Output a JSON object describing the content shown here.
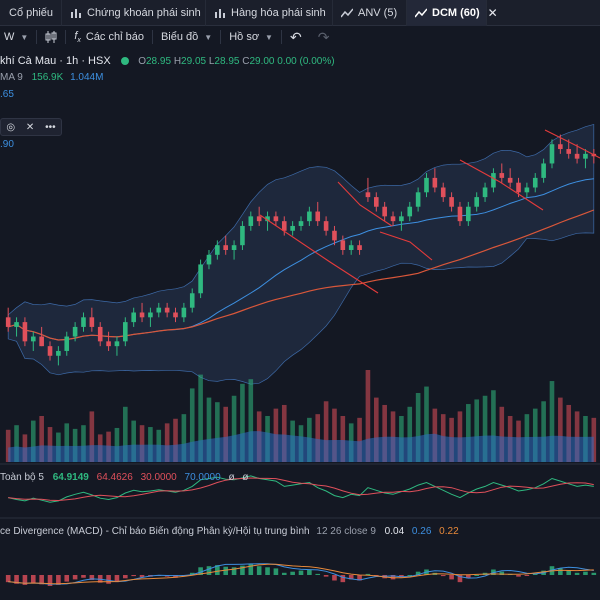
{
  "tabs": [
    {
      "label": "Cổ phiếu",
      "icon": "stock-icon",
      "active": false
    },
    {
      "label": "Chứng khoán phái sinh",
      "icon": "chart-bars-icon",
      "active": false
    },
    {
      "label": "Hàng hóa phái sinh",
      "icon": "chart-bars-icon",
      "active": false
    },
    {
      "label": "ANV (5)",
      "icon": "chart-line-icon",
      "active": false
    },
    {
      "label": "DCM (60)",
      "icon": "chart-line-icon",
      "active": true
    }
  ],
  "toolbar": {
    "interval_label": "W",
    "indicators_label": "Các chỉ báo",
    "chart_type_label": "Biểu đồ",
    "profile_label": "Hồ sơ"
  },
  "legend": {
    "symbol": "khí Cà Mau · 1h · HSX",
    "open_key": "O",
    "open": "28.95",
    "high_key": "H",
    "high": "29.05",
    "low_key": "L",
    "low": "28.95",
    "close_key": "C",
    "close": "29.00",
    "change": "0.00 (0.00%)"
  },
  "ma_row": {
    "label": "MA 9",
    "v1": "156.9K",
    "v2": "1.044M"
  },
  "price_labels": {
    "a": ".65",
    "b": ".90"
  },
  "rsi": {
    "name": "Toàn bộ 5",
    "v1": "64.9149",
    "v2": "64.4626",
    "v3": "30.0000",
    "v4": "70.0000",
    "v5": "ø",
    "v6": "ø"
  },
  "macd": {
    "name": "ce Divergence (MACD) - Chỉ báo Biến động Phân kỳ/Hội tụ trung bình",
    "params": "12 26 close 9",
    "v1": "0.04",
    "v2": "0.26",
    "v3": "0.22"
  },
  "colors": {
    "up": "#2fb980",
    "down": "#e0505b",
    "ma_fast": "#3d8fe0",
    "ma_slow": "#d9573a",
    "band_fill": "#2a3c5c",
    "annotation": "#e43b3b"
  },
  "chart_data": {
    "type": "candlestick",
    "price_ohlc": [
      [
        25.6,
        25.8,
        25.3,
        25.4
      ],
      [
        25.4,
        25.6,
        25.2,
        25.5
      ],
      [
        25.5,
        25.6,
        25.0,
        25.1
      ],
      [
        25.1,
        25.3,
        24.9,
        25.2
      ],
      [
        25.2,
        25.4,
        25.0,
        25.0
      ],
      [
        25.0,
        25.1,
        24.7,
        24.8
      ],
      [
        24.8,
        25.0,
        24.6,
        24.9
      ],
      [
        24.9,
        25.3,
        24.8,
        25.2
      ],
      [
        25.2,
        25.5,
        25.1,
        25.4
      ],
      [
        25.4,
        25.7,
        25.3,
        25.6
      ],
      [
        25.6,
        25.8,
        25.3,
        25.4
      ],
      [
        25.4,
        25.5,
        25.0,
        25.1
      ],
      [
        25.1,
        25.3,
        24.9,
        25.0
      ],
      [
        25.0,
        25.2,
        24.8,
        25.1
      ],
      [
        25.1,
        25.6,
        25.0,
        25.5
      ],
      [
        25.5,
        25.8,
        25.4,
        25.7
      ],
      [
        25.7,
        25.9,
        25.5,
        25.6
      ],
      [
        25.6,
        25.8,
        25.4,
        25.7
      ],
      [
        25.7,
        25.9,
        25.6,
        25.8
      ],
      [
        25.8,
        25.9,
        25.6,
        25.7
      ],
      [
        25.7,
        25.8,
        25.5,
        25.6
      ],
      [
        25.6,
        25.9,
        25.5,
        25.8
      ],
      [
        25.8,
        26.2,
        25.7,
        26.1
      ],
      [
        26.1,
        26.8,
        26.0,
        26.7
      ],
      [
        26.7,
        27.0,
        26.6,
        26.9
      ],
      [
        26.9,
        27.2,
        26.8,
        27.1
      ],
      [
        27.1,
        27.3,
        26.9,
        27.0
      ],
      [
        27.0,
        27.2,
        26.8,
        27.1
      ],
      [
        27.1,
        27.6,
        27.0,
        27.5
      ],
      [
        27.5,
        27.8,
        27.4,
        27.7
      ],
      [
        27.7,
        27.9,
        27.5,
        27.6
      ],
      [
        27.6,
        27.8,
        27.4,
        27.7
      ],
      [
        27.7,
        27.8,
        27.5,
        27.6
      ],
      [
        27.6,
        27.7,
        27.3,
        27.4
      ],
      [
        27.4,
        27.6,
        27.3,
        27.5
      ],
      [
        27.5,
        27.7,
        27.4,
        27.6
      ],
      [
        27.6,
        27.9,
        27.5,
        27.8
      ],
      [
        27.8,
        28.0,
        27.5,
        27.6
      ],
      [
        27.6,
        27.7,
        27.3,
        27.4
      ],
      [
        27.4,
        27.5,
        27.1,
        27.2
      ],
      [
        27.2,
        27.3,
        26.9,
        27.0
      ],
      [
        27.0,
        27.2,
        26.9,
        27.1
      ],
      [
        27.1,
        27.2,
        26.9,
        27.0
      ],
      [
        28.2,
        28.5,
        28.0,
        28.1
      ],
      [
        28.1,
        28.2,
        27.8,
        27.9
      ],
      [
        27.9,
        28.0,
        27.6,
        27.7
      ],
      [
        27.7,
        27.8,
        27.5,
        27.6
      ],
      [
        27.6,
        27.8,
        27.4,
        27.7
      ],
      [
        27.7,
        28.0,
        27.6,
        27.9
      ],
      [
        27.9,
        28.3,
        27.8,
        28.2
      ],
      [
        28.2,
        28.6,
        28.1,
        28.5
      ],
      [
        28.5,
        28.7,
        28.2,
        28.3
      ],
      [
        28.3,
        28.4,
        28.0,
        28.1
      ],
      [
        28.1,
        28.2,
        27.8,
        27.9
      ],
      [
        27.9,
        28.0,
        27.5,
        27.6
      ],
      [
        27.6,
        28.0,
        27.5,
        27.9
      ],
      [
        27.9,
        28.2,
        27.8,
        28.1
      ],
      [
        28.1,
        28.4,
        28.0,
        28.3
      ],
      [
        28.3,
        28.7,
        28.2,
        28.6
      ],
      [
        28.6,
        28.8,
        28.4,
        28.5
      ],
      [
        28.5,
        28.7,
        28.3,
        28.4
      ],
      [
        28.4,
        28.5,
        28.1,
        28.2
      ],
      [
        28.2,
        28.4,
        28.1,
        28.3
      ],
      [
        28.3,
        28.6,
        28.2,
        28.5
      ],
      [
        28.5,
        28.9,
        28.4,
        28.8
      ],
      [
        28.8,
        29.3,
        28.7,
        29.2
      ],
      [
        29.2,
        29.4,
        29.0,
        29.1
      ],
      [
        29.1,
        29.3,
        28.9,
        29.0
      ],
      [
        29.0,
        29.2,
        28.8,
        28.9
      ],
      [
        28.9,
        29.1,
        28.7,
        29.0
      ],
      [
        29.0,
        29.1,
        28.8,
        28.95
      ]
    ],
    "volume": [
      0.35,
      0.4,
      0.3,
      0.45,
      0.5,
      0.38,
      0.32,
      0.42,
      0.36,
      0.4,
      0.55,
      0.3,
      0.33,
      0.37,
      0.6,
      0.45,
      0.4,
      0.38,
      0.35,
      0.42,
      0.47,
      0.52,
      0.8,
      0.95,
      0.7,
      0.65,
      0.6,
      0.72,
      0.85,
      0.9,
      0.55,
      0.5,
      0.58,
      0.62,
      0.45,
      0.4,
      0.48,
      0.52,
      0.66,
      0.58,
      0.5,
      0.42,
      0.48,
      1.0,
      0.7,
      0.62,
      0.55,
      0.5,
      0.6,
      0.75,
      0.82,
      0.58,
      0.52,
      0.48,
      0.55,
      0.63,
      0.68,
      0.72,
      0.78,
      0.6,
      0.5,
      0.45,
      0.52,
      0.58,
      0.66,
      0.88,
      0.7,
      0.62,
      0.55,
      0.5,
      0.48
    ],
    "rsi": [
      45,
      42,
      40,
      44,
      41,
      38,
      40,
      46,
      50,
      53,
      49,
      44,
      42,
      45,
      52,
      56,
      54,
      55,
      57,
      55,
      53,
      56,
      62,
      72,
      74,
      76,
      73,
      72,
      75,
      78,
      74,
      72,
      70,
      62,
      64,
      66,
      68,
      60,
      55,
      48,
      45,
      50,
      48,
      60,
      56,
      52,
      50,
      54,
      58,
      64,
      68,
      62,
      56,
      50,
      45,
      52,
      58,
      62,
      68,
      64,
      60,
      55,
      57,
      60,
      66,
      74,
      70,
      66,
      62,
      64,
      62
    ]
  }
}
